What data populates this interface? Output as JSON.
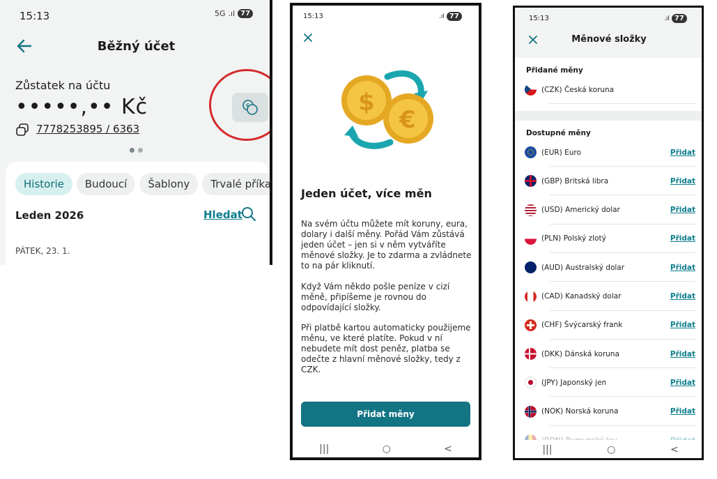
{
  "screen1": {
    "status_time": "15:13",
    "status_right": "5G",
    "battery": "77",
    "title": "Běžný účet",
    "balance_label": "Zůstatek na účtu",
    "balance_value": "•••••,•• Kč",
    "account_number": "7778253895 / 6363",
    "tabs": [
      "Historie",
      "Budoucí",
      "Šablony",
      "Trvalé příkaz"
    ],
    "month": "Leden 2026",
    "search_label": "Hledat",
    "day_header": "PÁTEK, 23. 1.",
    "icons": [
      "back-arrow-icon",
      "copy-icon",
      "currency-coins-icon",
      "search-icon"
    ],
    "colors": {
      "accent": "#0d7d8c",
      "highlight_ring": "#d42a2a",
      "active_tab_bg": "#d7f0ef"
    }
  },
  "screen2": {
    "status_time": "15:13",
    "battery": "77",
    "heading": "Jeden účet, více měn",
    "paragraph1": "Na svém účtu můžete mít koruny, eura, dolary i další měny. Pořád Vám zůstává jeden účet – jen si v něm vytváříte měnové složky. Je to zdarma a zvládnete to na pár kliknutí.",
    "paragraph2": "Když Vám někdo pošle peníze v cizí měně, připíšeme je rovnou do odpovídající složky.",
    "paragraph3": "Při platbě kartou automaticky použijeme měnu, ve které platíte. Pokud v ní nebudete mít dost peněz, platba se odečte z hlavní měnové složky, tedy z CZK.",
    "cta": "Přidat měny",
    "nav": [
      "|||",
      "○",
      "<"
    ],
    "colors": {
      "cta_bg": "#137484"
    }
  },
  "screen3": {
    "status_time": "15:13",
    "battery": "77",
    "title": "Měnové složky",
    "added_title": "Přidané měny",
    "added": [
      {
        "label": "(CZK) Česká koruna",
        "flag": "cz"
      }
    ],
    "available_title": "Dostupné měny",
    "add_label": "Přidat",
    "available": [
      {
        "label": "(EUR) Euro",
        "flag": "eu"
      },
      {
        "label": "(GBP) Britská libra",
        "flag": "gb"
      },
      {
        "label": "(USD) Americký dolar",
        "flag": "us"
      },
      {
        "label": "(PLN) Polský zlotý",
        "flag": "pl"
      },
      {
        "label": "(AUD) Australský dolar",
        "flag": "au"
      },
      {
        "label": "(CAD) Kanadský dolar",
        "flag": "ca"
      },
      {
        "label": "(CHF) Švýcarský frank",
        "flag": "ch"
      },
      {
        "label": "(DKK) Dánská koruna",
        "flag": "dk"
      },
      {
        "label": "(JPY) Japonský jen",
        "flag": "jp"
      },
      {
        "label": "(NOK) Norská koruna",
        "flag": "no"
      },
      {
        "label": "(RON) Rumunský lev",
        "flag": "ro"
      }
    ],
    "nav": [
      "|||",
      "○",
      "<"
    ]
  }
}
